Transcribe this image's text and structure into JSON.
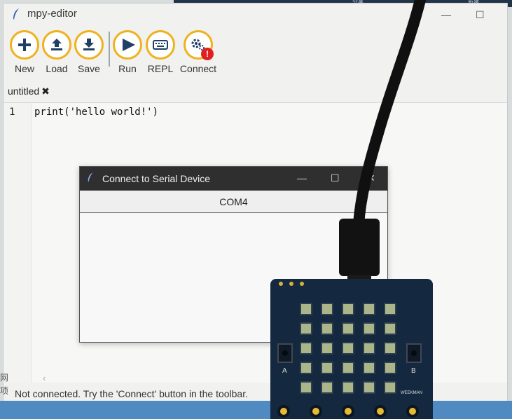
{
  "window": {
    "title": "mpy-editor",
    "controls": {
      "minimize": "—",
      "maximize": "☐"
    }
  },
  "toolbar": {
    "buttons": [
      {
        "id": "new",
        "label": "New",
        "icon": "plus-icon"
      },
      {
        "id": "load",
        "label": "Load",
        "icon": "upload-icon"
      },
      {
        "id": "save",
        "label": "Save",
        "icon": "download-icon"
      },
      {
        "id": "run",
        "label": "Run",
        "icon": "play-icon"
      },
      {
        "id": "repl",
        "label": "REPL",
        "icon": "keyboard-icon"
      },
      {
        "id": "connect",
        "label": "Connect",
        "icon": "gears-icon",
        "badge": "!"
      }
    ],
    "accent": "#efb21f"
  },
  "tabs": [
    {
      "label": "untitled",
      "close": "✖"
    }
  ],
  "editor": {
    "lines": [
      {
        "number": "1",
        "text": "print('hello world!')"
      }
    ],
    "scroll_hint": "‹"
  },
  "status": {
    "text": "Not connected. Try the 'Connect' button in the toolbar.",
    "side_chars": [
      "网",
      "项"
    ]
  },
  "dialog": {
    "title": "Connect to Serial Device",
    "controls": {
      "minimize": "—",
      "maximize": "☐",
      "close": "✕"
    },
    "ports": [
      "COM4"
    ]
  },
  "board": {
    "button_labels": [
      "A",
      "B"
    ],
    "brand": "WEEKMAN"
  },
  "background_window": {
    "texts": [
      "分享",
      "新建"
    ]
  }
}
